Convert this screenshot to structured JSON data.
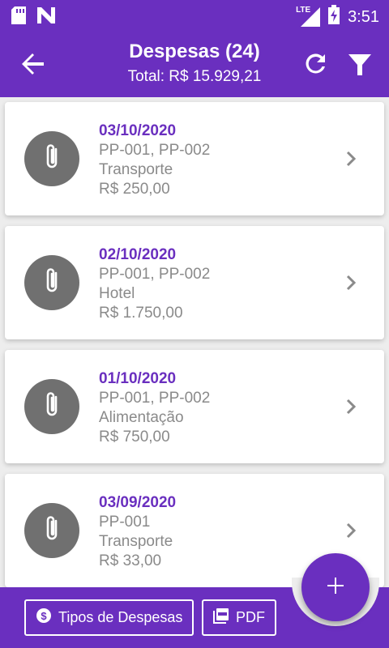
{
  "status_bar": {
    "time": "3:51",
    "network": "LTE"
  },
  "appbar": {
    "title": "Despesas (24)",
    "subtitle": "Total: R$ 15.929,21"
  },
  "expenses": [
    {
      "date": "03/10/2020",
      "codes": "PP-001, PP-002",
      "category": "Transporte",
      "amount": "R$ 250,00"
    },
    {
      "date": "02/10/2020",
      "codes": "PP-001, PP-002",
      "category": "Hotel",
      "amount": "R$ 1.750,00"
    },
    {
      "date": "01/10/2020",
      "codes": "PP-001, PP-002",
      "category": "Alimentação",
      "amount": "R$ 750,00"
    },
    {
      "date": "03/09/2020",
      "codes": "PP-001",
      "category": "Transporte",
      "amount": "R$ 33,00"
    }
  ],
  "bottom": {
    "types_label": "Tipos de Despesas",
    "pdf_label": "PDF"
  },
  "colors": {
    "primary": "#6a2fbf",
    "avatar": "#707070",
    "text_muted": "#8a8a8a"
  }
}
